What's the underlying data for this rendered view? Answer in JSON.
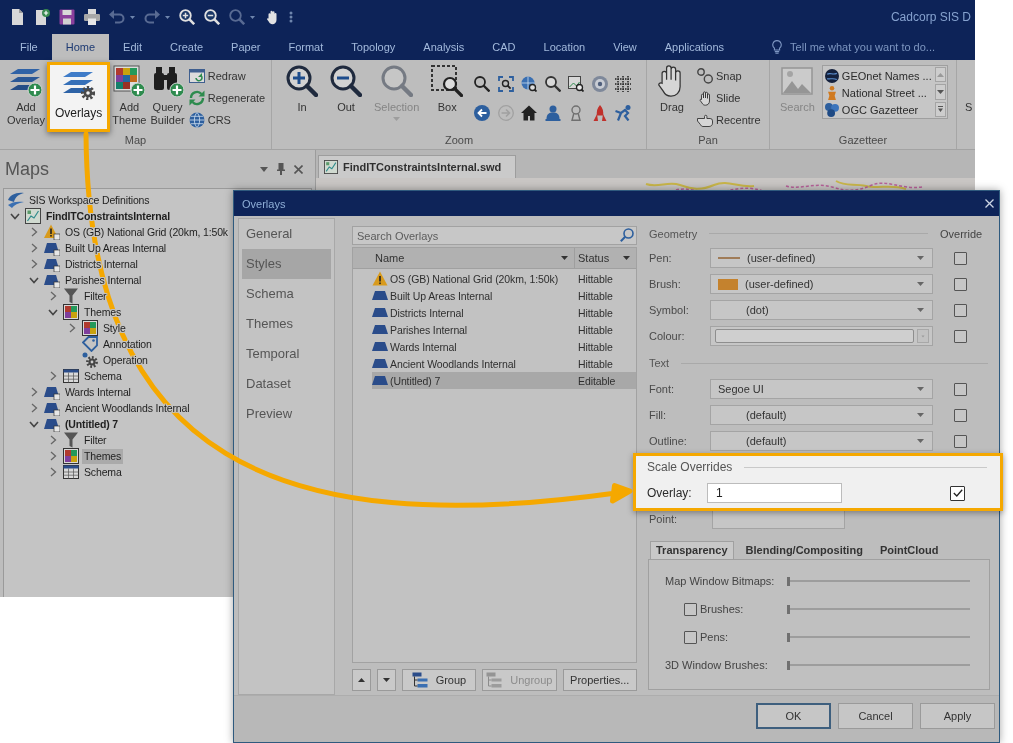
{
  "app": {
    "title": "Cadcorp SIS D",
    "quick_access": [
      {
        "disabled": false,
        "dropdown": false
      },
      {
        "disabled": false,
        "dropdown": false
      },
      {
        "disabled": false,
        "dropdown": false
      },
      {
        "disabled": false,
        "dropdown": false
      },
      {
        "disabled": true,
        "dropdown": true
      },
      {
        "disabled": true,
        "dropdown": true
      },
      {
        "disabled": false,
        "dropdown": false
      },
      {
        "disabled": false,
        "dropdown": false
      },
      {
        "disabled": true,
        "dropdown": true
      },
      {
        "disabled": false,
        "dropdown": false
      }
    ],
    "tabs": [
      {
        "label": "File",
        "selected": false
      },
      {
        "label": "Home",
        "selected": true
      },
      {
        "label": "Edit",
        "selected": false
      },
      {
        "label": "Create",
        "selected": false
      },
      {
        "label": "Paper",
        "selected": false
      },
      {
        "label": "Format",
        "selected": false
      },
      {
        "label": "Topology",
        "selected": false
      },
      {
        "label": "Analysis",
        "selected": false
      },
      {
        "label": "CAD",
        "selected": false
      },
      {
        "label": "Location",
        "selected": false
      },
      {
        "label": "View",
        "selected": false
      },
      {
        "label": "Applications",
        "selected": false
      }
    ],
    "tell_me": {
      "placeholder": "Tell me what you want to do..."
    },
    "ribbon": {
      "groups": [
        {
          "kind": "map",
          "label": "Map",
          "large": [
            {
              "label": "Add Overlay",
              "highlighted": false
            },
            {
              "label": "Overlays",
              "highlighted": true
            },
            {
              "label": "Add Theme",
              "highlighted": false
            },
            {
              "label": "Query Builder",
              "highlighted": false
            }
          ],
          "small": [
            {
              "label": "Redraw"
            },
            {
              "label": "Regenerate"
            },
            {
              "label": "CRS"
            }
          ]
        },
        {
          "kind": "zoom",
          "label": "Zoom",
          "large": [
            {
              "label": "In",
              "disabled": false,
              "dropdown": false
            },
            {
              "label": "Out",
              "disabled": false,
              "dropdown": false
            },
            {
              "label": "Selection",
              "disabled": true,
              "dropdown": true
            },
            {
              "label": "Box",
              "disabled": false,
              "dropdown": false
            }
          ],
          "tools": [
            {
              "disabled": false
            },
            {
              "disabled": false
            },
            {
              "disabled": false
            },
            {
              "disabled": false
            },
            {
              "disabled": false
            },
            {
              "disabled": false
            },
            {
              "disabled": false
            },
            {
              "disabled": false
            },
            {
              "disabled": true
            },
            {
              "disabled": false
            },
            {
              "disabled": false
            },
            {
              "disabled": false
            },
            {
              "disabled": false
            },
            {
              "disabled": false
            }
          ]
        },
        {
          "kind": "pan",
          "label": "Pan",
          "large": [
            {
              "label": "Drag",
              "disabled": false
            }
          ],
          "small": [
            {
              "label": "Snap"
            },
            {
              "label": "Slide"
            },
            {
              "label": "Recentre"
            }
          ]
        },
        {
          "kind": "gazetteer",
          "label": "Gazetteer",
          "large": [
            {
              "label": "Search",
              "disabled": true
            }
          ],
          "entries": [
            {
              "label": "GEOnet Names ..."
            },
            {
              "label": "National Street ..."
            },
            {
              "label": "OGC Gazetteer"
            }
          ]
        },
        {
          "kind": "clipped",
          "large": [
            {
              "label": "S"
            }
          ]
        }
      ]
    },
    "maps_panel": {
      "title": "Maps",
      "tree": [
        {
          "kind": "workspace",
          "label": "SIS Workspace Definitions",
          "selected": false,
          "emphasized": false
        },
        {
          "kind": "map",
          "label": "FindITConstraintsInternal",
          "expanded": true,
          "selected": false,
          "emphasized": true,
          "children": [
            {
              "kind": "warning",
              "label": "OS (GB) National Grid (20km, 1:50k",
              "expanded": false,
              "selected": false,
              "emphasized": false
            },
            {
              "kind": "layer",
              "label": "Built Up Areas Internal",
              "expanded": false,
              "selected": false,
              "emphasized": false
            },
            {
              "kind": "layer",
              "label": "Districts Internal",
              "expanded": false,
              "selected": false,
              "emphasized": false
            },
            {
              "kind": "layer",
              "label": "Parishes Internal",
              "expanded": true,
              "selected": false,
              "emphasized": false,
              "children": [
                {
                  "kind": "filter",
                  "label": "Filter",
                  "expanded": false,
                  "selected": false,
                  "emphasized": false
                },
                {
                  "kind": "themes",
                  "label": "Themes",
                  "expanded": true,
                  "selected": false,
                  "emphasized": false,
                  "children": [
                    {
                      "kind": "themes",
                      "label": "Style",
                      "expanded": false,
                      "selected": false,
                      "emphasized": false
                    },
                    {
                      "kind": "annotation",
                      "label": "Annotation",
                      "selected": false,
                      "emphasized": false
                    },
                    {
                      "kind": "operation",
                      "label": "Operation",
                      "selected": false,
                      "emphasized": false
                    }
                  ]
                },
                {
                  "kind": "schema",
                  "label": "Schema",
                  "expanded": false,
                  "selected": false,
                  "emphasized": false
                }
              ]
            },
            {
              "kind": "layer",
              "label": "Wards Internal",
              "expanded": false,
              "selected": false,
              "emphasized": false
            },
            {
              "kind": "layer",
              "label": "Ancient Woodlands Internal",
              "expanded": false,
              "selected": false,
              "emphasized": false
            },
            {
              "kind": "layer",
              "label": "(Untitled) 7",
              "expanded": true,
              "selected": false,
              "emphasized": true,
              "children": [
                {
                  "kind": "filter",
                  "label": "Filter",
                  "expanded": false,
                  "selected": false,
                  "emphasized": false
                },
                {
                  "kind": "themes",
                  "label": "Themes",
                  "expanded": false,
                  "selected": true,
                  "emphasized": false
                },
                {
                  "kind": "schema",
                  "label": "Schema",
                  "expanded": false,
                  "selected": false,
                  "emphasized": false
                }
              ]
            }
          ]
        }
      ]
    },
    "document": {
      "tab": "FindITConstraintsInternal.swd"
    }
  },
  "dialog": {
    "title": "Overlays",
    "nav": [
      {
        "label": "General",
        "selected": false
      },
      {
        "label": "Styles",
        "selected": true
      },
      {
        "label": "Schema",
        "selected": false
      },
      {
        "label": "Themes",
        "selected": false
      },
      {
        "label": "Temporal",
        "selected": false
      },
      {
        "label": "Dataset",
        "selected": false
      },
      {
        "label": "Preview",
        "selected": false
      }
    ],
    "search": {
      "placeholder": "Search Overlays"
    },
    "overlay_list": {
      "columns": [
        "Name",
        "Status"
      ],
      "rows": [
        {
          "kind": "warning",
          "name": "OS (GB) National Grid (20km, 1:50k)",
          "status": "Hittable",
          "selected": false
        },
        {
          "kind": "layer",
          "name": "Built Up Areas Internal",
          "status": "Hittable",
          "selected": false
        },
        {
          "kind": "layer",
          "name": "Districts Internal",
          "status": "Hittable",
          "selected": false
        },
        {
          "kind": "layer",
          "name": "Parishes Internal",
          "status": "Hittable",
          "selected": false
        },
        {
          "kind": "layer",
          "name": "Wards Internal",
          "status": "Hittable",
          "selected": false
        },
        {
          "kind": "layer",
          "name": "Ancient Woodlands Internal",
          "status": "Hittable",
          "selected": false
        },
        {
          "kind": "layer",
          "name": "(Untitled) 7",
          "status": "Editable",
          "selected": true
        }
      ]
    },
    "list_buttons": [
      {
        "kind": "up",
        "disabled": false
      },
      {
        "kind": "down",
        "disabled": false
      },
      {
        "kind": "group",
        "label": "Group",
        "disabled": false
      },
      {
        "kind": "ungroup",
        "label": "Ungroup",
        "disabled": true
      },
      {
        "kind": "properties",
        "label": "Properties...",
        "disabled": false
      }
    ],
    "geometry": {
      "title": "Geometry",
      "override_heading": "Override",
      "rows": [
        {
          "kind": "line",
          "label": "Pen:",
          "value": "(user-defined)",
          "color": "#a07c58",
          "override": false
        },
        {
          "kind": "fill",
          "label": "Brush:",
          "value": "(user-defined)",
          "color": "#c4822e",
          "override": false
        },
        {
          "kind": "blank",
          "label": "Symbol:",
          "value": "(dot)",
          "override": false
        },
        {
          "kind": "colour",
          "label": "Colour:",
          "override": false
        }
      ]
    },
    "text": {
      "title": "Text",
      "rows": [
        {
          "kind": "plain",
          "label": "Font:",
          "value": "Segoe UI",
          "override": false
        },
        {
          "kind": "blank",
          "label": "Fill:",
          "value": "(default)",
          "override": false
        },
        {
          "kind": "blank",
          "label": "Outline:",
          "value": "(default)",
          "override": false
        }
      ]
    },
    "scale_overrides": {
      "title": "Scale Overrides",
      "highlighted": true,
      "rows": [
        {
          "label": "Overlay:",
          "value": "1",
          "override": true
        }
      ]
    },
    "point": {
      "label": "Point:"
    },
    "tabs": [
      {
        "label": "Transparency",
        "selected": true
      },
      {
        "label": "Blending/Compositing",
        "selected": false
      },
      {
        "label": "PointCloud",
        "selected": false
      }
    ],
    "transparency": [
      {
        "kind": "plain",
        "label": "Map Window Bitmaps:",
        "level": 0
      },
      {
        "kind": "check",
        "label": "Brushes:",
        "checked": false,
        "level": 0
      },
      {
        "kind": "check",
        "label": "Pens:",
        "checked": false,
        "level": 0
      },
      {
        "kind": "plain",
        "label": "3D Window Brushes:",
        "level": 0
      }
    ],
    "buttons": [
      {
        "label": "OK",
        "default": true
      },
      {
        "label": "Cancel",
        "default": false
      },
      {
        "label": "Apply",
        "default": false
      }
    ]
  }
}
